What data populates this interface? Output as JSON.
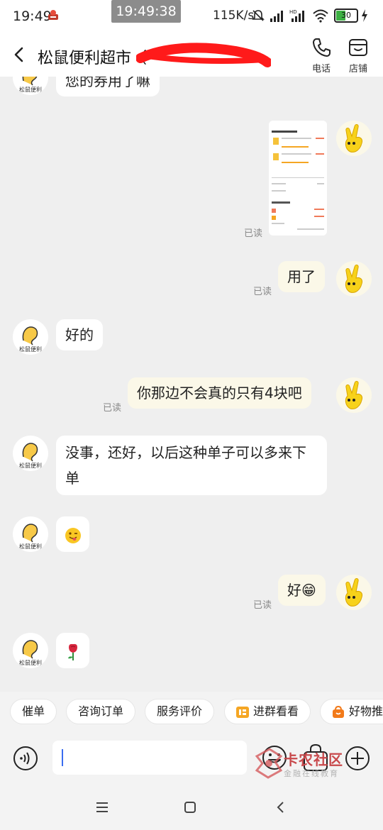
{
  "status_bar": {
    "time": "19:49",
    "overlay_clock": "19:49:38",
    "network_speed": "115K/s",
    "battery": "30",
    "icons": [
      "app-notification-icon",
      "mute-icon",
      "signal-icon",
      "signal-hd-icon",
      "wifi-icon",
      "battery-icon",
      "charging-icon"
    ]
  },
  "header": {
    "title": "松鼠便利超市（",
    "call_label": "电话",
    "store_label": "店铺"
  },
  "messages": [
    {
      "side": "left",
      "type": "text",
      "text": "您的券用了嘛"
    },
    {
      "side": "right",
      "type": "image",
      "read": "已读"
    },
    {
      "side": "right",
      "type": "text",
      "text": "用了",
      "read": "已读"
    },
    {
      "side": "left",
      "type": "text",
      "text": "好的"
    },
    {
      "side": "right",
      "type": "text",
      "text": "你那边不会真的只有4块吧",
      "read": "已读"
    },
    {
      "side": "left",
      "type": "text",
      "text": "没事，还好，以后这种单子可以多来下单"
    },
    {
      "side": "left",
      "type": "emoji",
      "text": "😜"
    },
    {
      "side": "right",
      "type": "text",
      "text": "好😁",
      "read": "已读"
    },
    {
      "side": "left",
      "type": "emoji",
      "text": "🌹"
    }
  ],
  "avatar_caption": "松鼠便利",
  "quick_replies": [
    {
      "label": "催单"
    },
    {
      "label": "咨询订单"
    },
    {
      "label": "服务评价"
    },
    {
      "label": "进群看看",
      "icon": "group-icon"
    },
    {
      "label": "好物推",
      "icon": "shopping-bag-icon"
    }
  ],
  "input": {
    "placeholder": "",
    "value": ""
  },
  "watermark": {
    "text": "卡农社区",
    "sub": "金融在线教育"
  },
  "colors": {
    "background": "#efefef",
    "my_bubble": "#fbf8e8",
    "their_bubble": "#ffffff",
    "accent_orange": "#f5a623",
    "watermark_red": "#c8484b"
  }
}
